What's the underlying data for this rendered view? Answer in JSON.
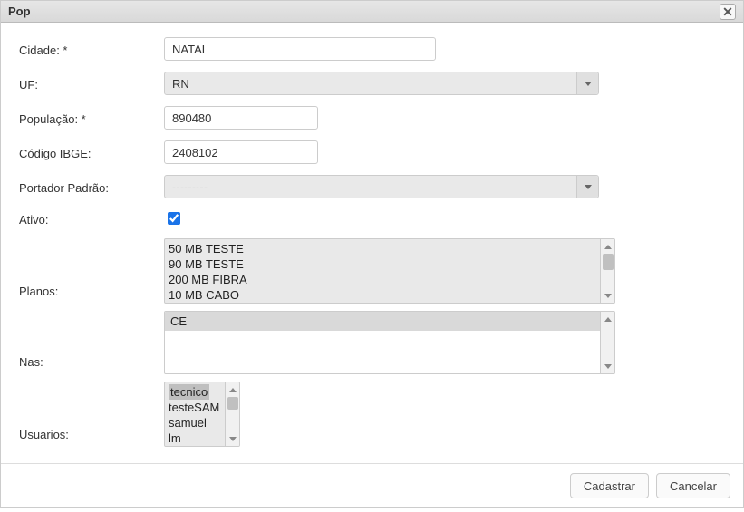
{
  "dialog": {
    "title": "Pop",
    "close_icon": "✕"
  },
  "labels": {
    "cidade": "Cidade: *",
    "uf": "UF:",
    "populacao": "População: *",
    "codigo_ibge": "Código IBGE:",
    "portador_padrao": "Portador Padrão:",
    "ativo": "Ativo:",
    "planos": "Planos:",
    "nas": "Nas:",
    "usuarios": "Usuarios:"
  },
  "fields": {
    "cidade": "NATAL",
    "uf": "RN",
    "populacao": "890480",
    "codigo_ibge": "2408102",
    "portador_padrao": "---------",
    "ativo_checked": true
  },
  "planos": {
    "items": [
      "50 MB TESTE",
      "90 MB TESTE",
      "200 MB FIBRA",
      "10 MB CABO"
    ]
  },
  "nas": {
    "items": [
      "CE"
    ]
  },
  "usuarios": {
    "items": [
      "tecnico",
      "testeSAM",
      "samuel",
      "lm"
    ]
  },
  "buttons": {
    "submit": "Cadastrar",
    "cancel": "Cancelar"
  }
}
